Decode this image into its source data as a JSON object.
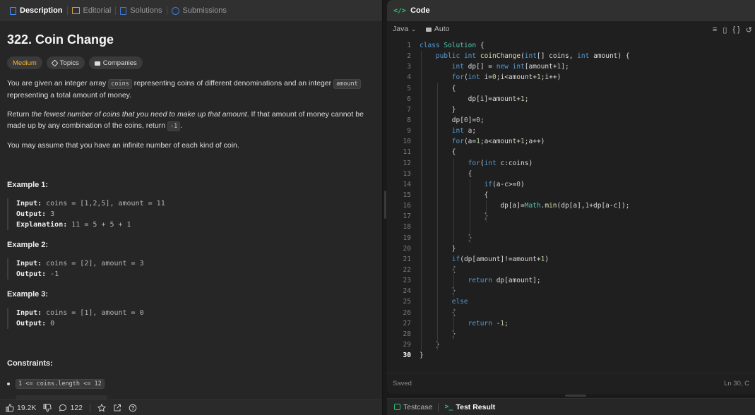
{
  "left_tabs": [
    {
      "label": "Description",
      "icon": "description-icon"
    },
    {
      "label": "Editorial",
      "icon": "editorial-icon"
    },
    {
      "label": "Solutions",
      "icon": "solutions-icon"
    },
    {
      "label": "Submissions",
      "icon": "submissions-icon"
    }
  ],
  "problem": {
    "title": "322. Coin Change",
    "difficulty": "Medium",
    "topics_label": "Topics",
    "companies_label": "Companies",
    "desc1_a": "You are given an integer array ",
    "desc1_code1": "coins",
    "desc1_b": " representing coins of different denominations and an integer ",
    "desc1_code2": "amount",
    "desc1_c": " representing a total amount of money.",
    "desc2_a": "Return ",
    "desc2_em": "the fewest number of coins that you need to make up that amount",
    "desc2_b": ". If that amount of money cannot be made up by any combination of the coins, return ",
    "desc2_code": "-1",
    "desc2_c": ".",
    "desc3": "You may assume that you have an infinite number of each kind of coin.",
    "examples": [
      {
        "title": "Example 1:",
        "input_label": "Input:",
        "input": " coins = [1,2,5], amount = 11",
        "output_label": "Output:",
        "output": " 3",
        "expl_label": "Explanation:",
        "expl": " 11 = 5 + 5 + 1"
      },
      {
        "title": "Example 2:",
        "input_label": "Input:",
        "input": " coins = [2], amount = 3",
        "output_label": "Output:",
        "output": " -1"
      },
      {
        "title": "Example 3:",
        "input_label": "Input:",
        "input": " coins = [1], amount = 0",
        "output_label": "Output:",
        "output": " 0"
      }
    ],
    "constraints_title": "Constraints:",
    "constraint1": "1 <= coins.length <= 12"
  },
  "footer": {
    "likes": "19.2K",
    "comments": "122"
  },
  "code_panel": {
    "title": "Code",
    "language": "Java",
    "mode": "Auto",
    "status": "Saved",
    "cursor": "Ln 30, C"
  },
  "code_lines": [
    "class Solution {",
    "    public int coinChange(int[] coins, int amount) {",
    "        int dp[] = new int[amount+1];",
    "        for(int i=0;i<amount+1;i++)",
    "        {",
    "            dp[i]=amount+1;",
    "        }",
    "        dp[0]=0;",
    "        int a;",
    "        for(a=1;a<amount+1;a++)",
    "        {",
    "            for(int c:coins)",
    "            {",
    "                if(a-c>=0)",
    "                {",
    "                    dp[a]=Math.min(dp[a],1+dp[a-c]);",
    "                }",
    "",
    "            }",
    "        }",
    "        if(dp[amount]!=amount+1)",
    "        {",
    "            return dp[amount];",
    "        }",
    "        else",
    "        {",
    "            return -1;",
    "        }",
    "    }",
    "}"
  ],
  "console_tabs": {
    "testcase": "Testcase",
    "result": "Test Result"
  }
}
